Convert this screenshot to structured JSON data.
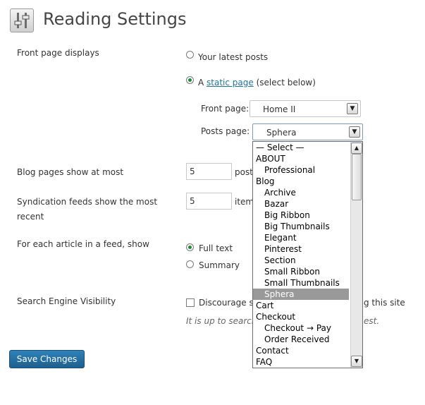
{
  "page": {
    "title": "Reading Settings",
    "icon": "settings-sliders-icon"
  },
  "front_page_displays": {
    "label": "Front page displays",
    "option_latest": "Your latest posts",
    "option_static_prefix": "A ",
    "option_static_link": "static page",
    "option_static_suffix": " (select below)",
    "selected": "static"
  },
  "front_page": {
    "label": "Front page:",
    "value": "Home II"
  },
  "posts_page": {
    "label": "Posts page:",
    "value": "Sphera",
    "options": [
      {
        "label": "— Select —",
        "child": false
      },
      {
        "label": "ABOUT",
        "child": false
      },
      {
        "label": "Professional",
        "child": true
      },
      {
        "label": "Blog",
        "child": false
      },
      {
        "label": "Archive",
        "child": true
      },
      {
        "label": "Bazar",
        "child": true
      },
      {
        "label": "Big Ribbon",
        "child": true
      },
      {
        "label": "Big Thumbnails",
        "child": true
      },
      {
        "label": "Elegant",
        "child": true
      },
      {
        "label": "Pinterest",
        "child": true
      },
      {
        "label": "Section",
        "child": true
      },
      {
        "label": "Small Ribbon",
        "child": true
      },
      {
        "label": "Small Thumbnails",
        "child": true
      },
      {
        "label": "Sphera",
        "child": true,
        "selected": true
      },
      {
        "label": "Cart",
        "child": false
      },
      {
        "label": "Checkout",
        "child": false
      },
      {
        "label": "Checkout → Pay",
        "child": true
      },
      {
        "label": "Order Received",
        "child": true
      },
      {
        "label": "Contact",
        "child": false
      },
      {
        "label": "FAQ",
        "child": false
      }
    ]
  },
  "blog_pages": {
    "label": "Blog pages show at most",
    "value": "5",
    "unit": "post"
  },
  "syndication": {
    "label_line1": "Syndication feeds show the most",
    "label_line2": "recent",
    "value": "5",
    "unit": "item"
  },
  "feed_article": {
    "label": "For each article in a feed, show",
    "option_full": "Full text",
    "option_summary": "Summary",
    "selected": "full"
  },
  "search_visibility": {
    "label": "Search Engine Visibility",
    "checkbox_text_left": "Discourage s",
    "checkbox_text_right": "g this site",
    "hint_left": "It is up to search",
    "hint_right": "est."
  },
  "save_button": "Save Changes",
  "colors": {
    "accent_link": "#21759b",
    "button": "#2473a6",
    "radio_checked": "#1e8a2e",
    "dropdown_selected": "#999999"
  }
}
